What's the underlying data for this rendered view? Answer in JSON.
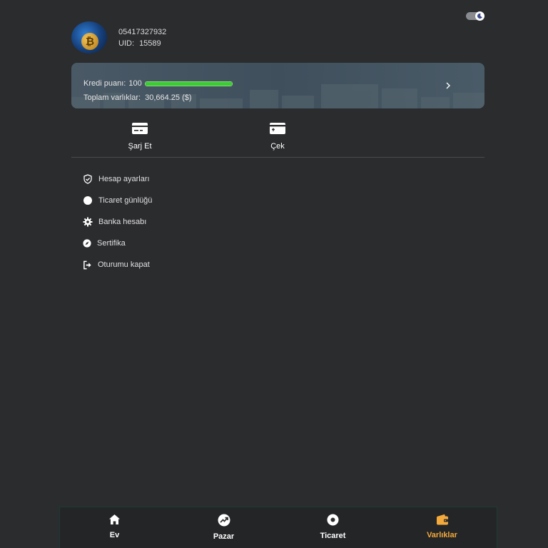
{
  "profile": {
    "phone": "05417327932",
    "uid_label": "UID:",
    "uid_value": "15589"
  },
  "credit_card": {
    "credit_label": "Kredi puanı:",
    "credit_value": "100",
    "credit_progress": 1.0,
    "assets_label": "Toplam varlıklar:",
    "assets_value": "30,664.25 ($)"
  },
  "actions": [
    {
      "label": "Şarj Et",
      "icon": "card-deposit-icon"
    },
    {
      "label": "Çek",
      "icon": "card-withdraw-icon"
    }
  ],
  "menu": [
    {
      "label": "Hesap ayarları",
      "icon": "shield-check-icon"
    },
    {
      "label": "Ticaret günlüğü",
      "icon": "circle-icon"
    },
    {
      "label": "Banka hesabı",
      "icon": "gear-icon"
    },
    {
      "label": "Sertifika",
      "icon": "compass-icon"
    },
    {
      "label": "Oturumu kapat",
      "icon": "logout-icon"
    }
  ],
  "bottom_nav": [
    {
      "label": "Ev",
      "icon": "home-icon",
      "active": false
    },
    {
      "label": "Pazar",
      "icon": "trending-up-icon",
      "active": false
    },
    {
      "label": "Ticaret",
      "icon": "trade-icon",
      "active": false
    },
    {
      "label": "Varlıklar",
      "icon": "wallet-icon",
      "active": true
    }
  ],
  "colors": {
    "background": "#2b2c2e",
    "accent": "#f3a93b",
    "progress": "#3fc93a",
    "card": "#45535f"
  }
}
